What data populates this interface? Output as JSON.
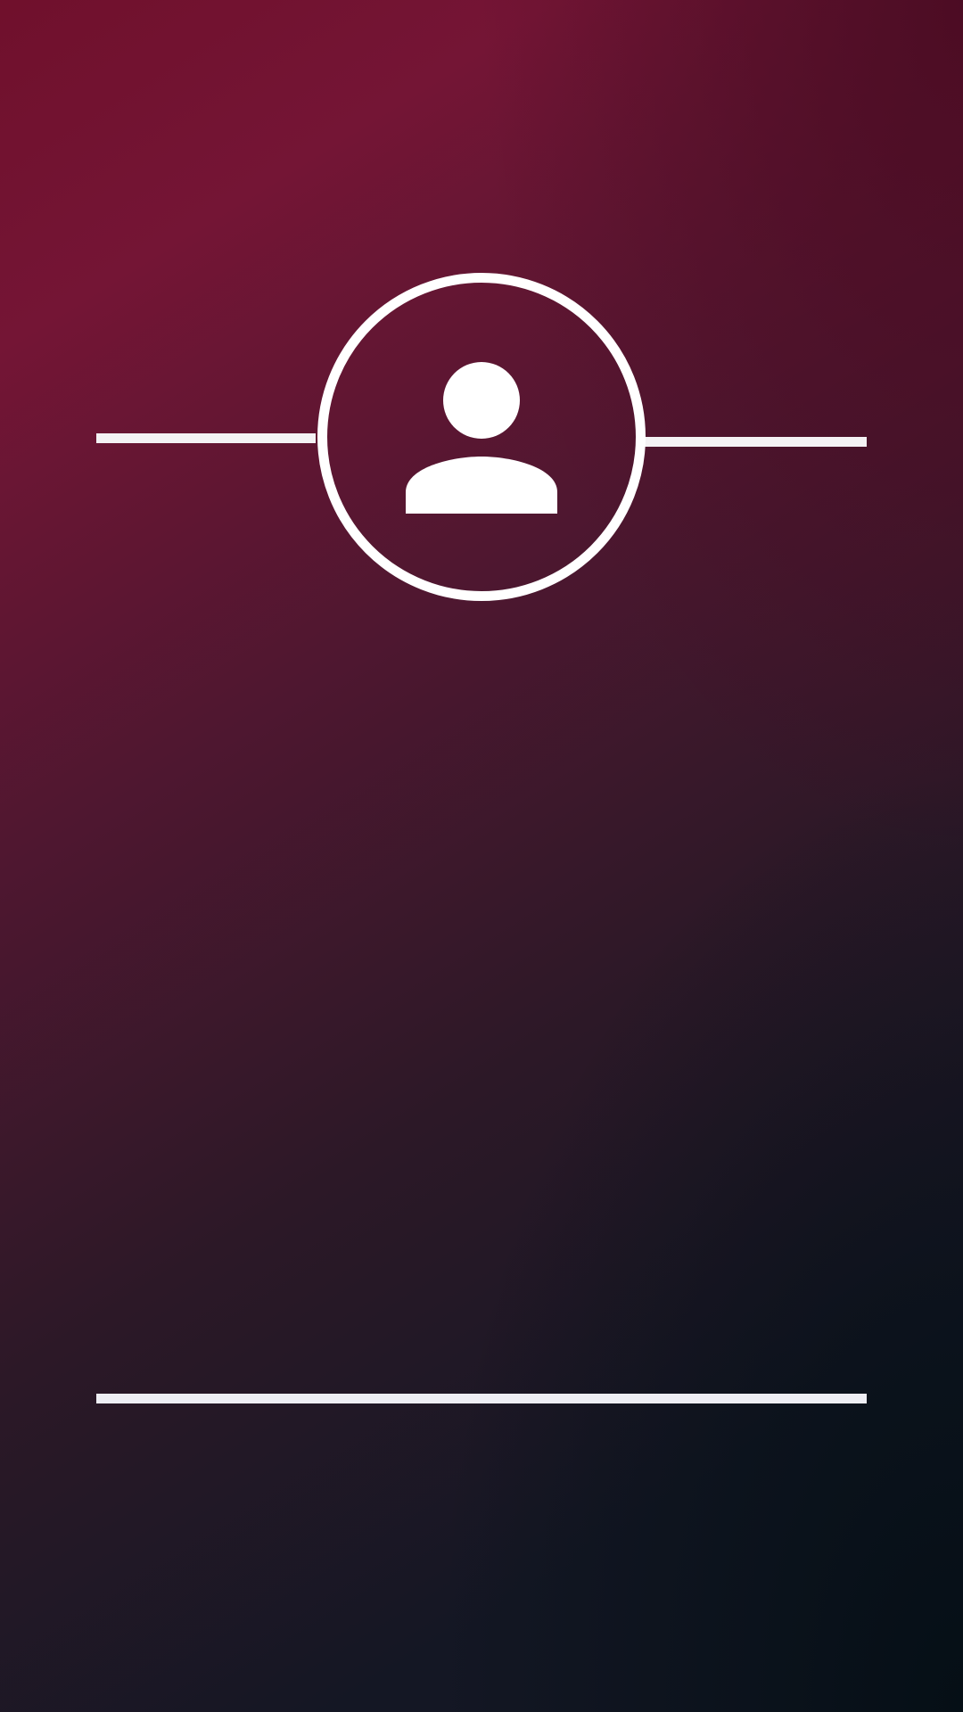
{
  "theme": {
    "gradient_top": "#741535",
    "gradient_mid": "#4f1730",
    "gradient_bottom": "#141724",
    "corner_dark": "#050f16",
    "foreground": "#ffffff"
  },
  "avatar": {
    "icon": "user-icon"
  }
}
